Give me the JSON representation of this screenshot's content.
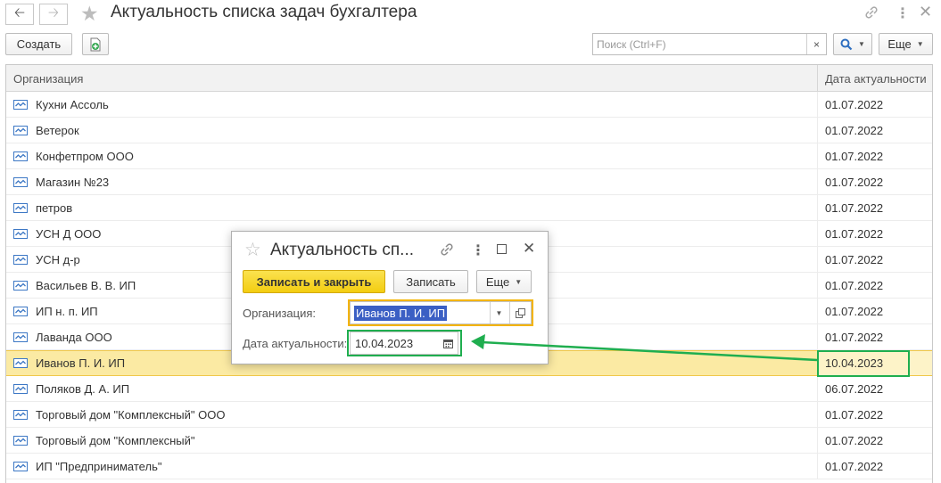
{
  "window": {
    "title": "Актуальность списка задач бухгалтера"
  },
  "toolbar": {
    "create_label": "Создать",
    "search_placeholder": "Поиск (Ctrl+F)",
    "clear_symbol": "×",
    "more_label": "Еще"
  },
  "table": {
    "columns": [
      "Организация",
      "Дата актуальности"
    ],
    "rows": [
      {
        "org": "Кухни Ассоль",
        "date": "01.07.2022"
      },
      {
        "org": "Ветерок",
        "date": "01.07.2022"
      },
      {
        "org": "Конфетпром ООО",
        "date": "01.07.2022"
      },
      {
        "org": "Магазин №23",
        "date": "01.07.2022"
      },
      {
        "org": "петров",
        "date": "01.07.2022"
      },
      {
        "org": "УСН Д ООО",
        "date": "01.07.2022"
      },
      {
        "org": "УСН д-р",
        "date": "01.07.2022"
      },
      {
        "org": "Васильев В. В. ИП",
        "date": "01.07.2022"
      },
      {
        "org": "ИП н. п. ИП",
        "date": "01.07.2022"
      },
      {
        "org": "Лаванда ООО",
        "date": "01.07.2022"
      },
      {
        "org": "Иванов П. И. ИП",
        "date": "10.04.2023"
      },
      {
        "org": "Поляков Д. А. ИП",
        "date": "06.07.2022"
      },
      {
        "org": "Торговый дом \"Комплексный\" ООО",
        "date": "01.07.2022"
      },
      {
        "org": "Торговый дом \"Комплексный\"",
        "date": "01.07.2022"
      },
      {
        "org": "ИП \"Предприниматель\"",
        "date": "01.07.2022"
      }
    ],
    "selected_row": 10
  },
  "dialog": {
    "title": "Актуальность сп...",
    "save_close_label": "Записать и закрыть",
    "save_label": "Записать",
    "more_label": "Еще",
    "org_label": "Организация:",
    "org_value": "Иванов П. И. ИП",
    "date_label": "Дата актуальности:",
    "date_value": "10.04.2023"
  },
  "colors": {
    "selection": "#fbeaa3",
    "primary_button": "#f3cd11",
    "highlight_orange": "#f4b400",
    "highlight_green": "#1fae4f",
    "search_accent": "#2f6fc0"
  },
  "icons": [
    "back-arrow-icon",
    "forward-arrow-icon",
    "star-icon",
    "link-icon",
    "kebab-icon",
    "close-icon",
    "add-document-icon",
    "search-icon",
    "dropdown-arrow-icon",
    "calendar-icon",
    "open-form-icon",
    "organization-icon"
  ]
}
